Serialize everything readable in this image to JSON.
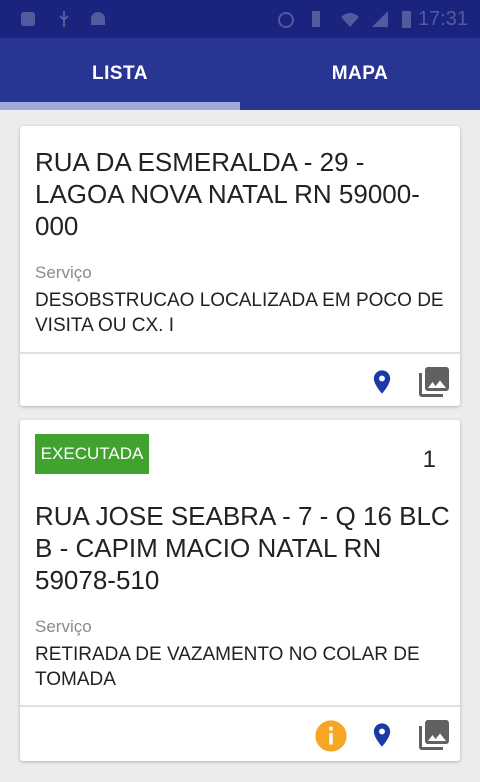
{
  "status_bar": {
    "time": "17:31"
  },
  "tabs": [
    {
      "label": "LISTA"
    },
    {
      "label": "MAPA"
    }
  ],
  "cards": [
    {
      "address": "RUA DA ESMERALDA - 29 - LAGOA NOVA NATAL RN 59000-000",
      "service_label": "Serviço",
      "service": "DESOBSTRUCAO LOCALIZADA EM POCO DE VISITA OU CX. I",
      "actions": [
        "location-pin-icon",
        "gallery-icon"
      ]
    },
    {
      "status": "EXECUTADA",
      "count": "1",
      "address": "RUA JOSE SEABRA - 7 - Q 16 BLC B - CAPIM MACIO NATAL RN 59078-510",
      "service_label": "Serviço",
      "service": "RETIRADA DE VAZAMENTO NO COLAR DE TOMADA",
      "actions": [
        "info-icon",
        "location-pin-icon",
        "gallery-icon"
      ]
    }
  ],
  "colors": {
    "status_bar": "#1a237e",
    "app_bar": "#283593",
    "tab_indicator": "#9fa8da",
    "badge": "#3fa32e",
    "pin": "#1a3aa8",
    "info": "#f5a623",
    "gallery": "#616161"
  }
}
